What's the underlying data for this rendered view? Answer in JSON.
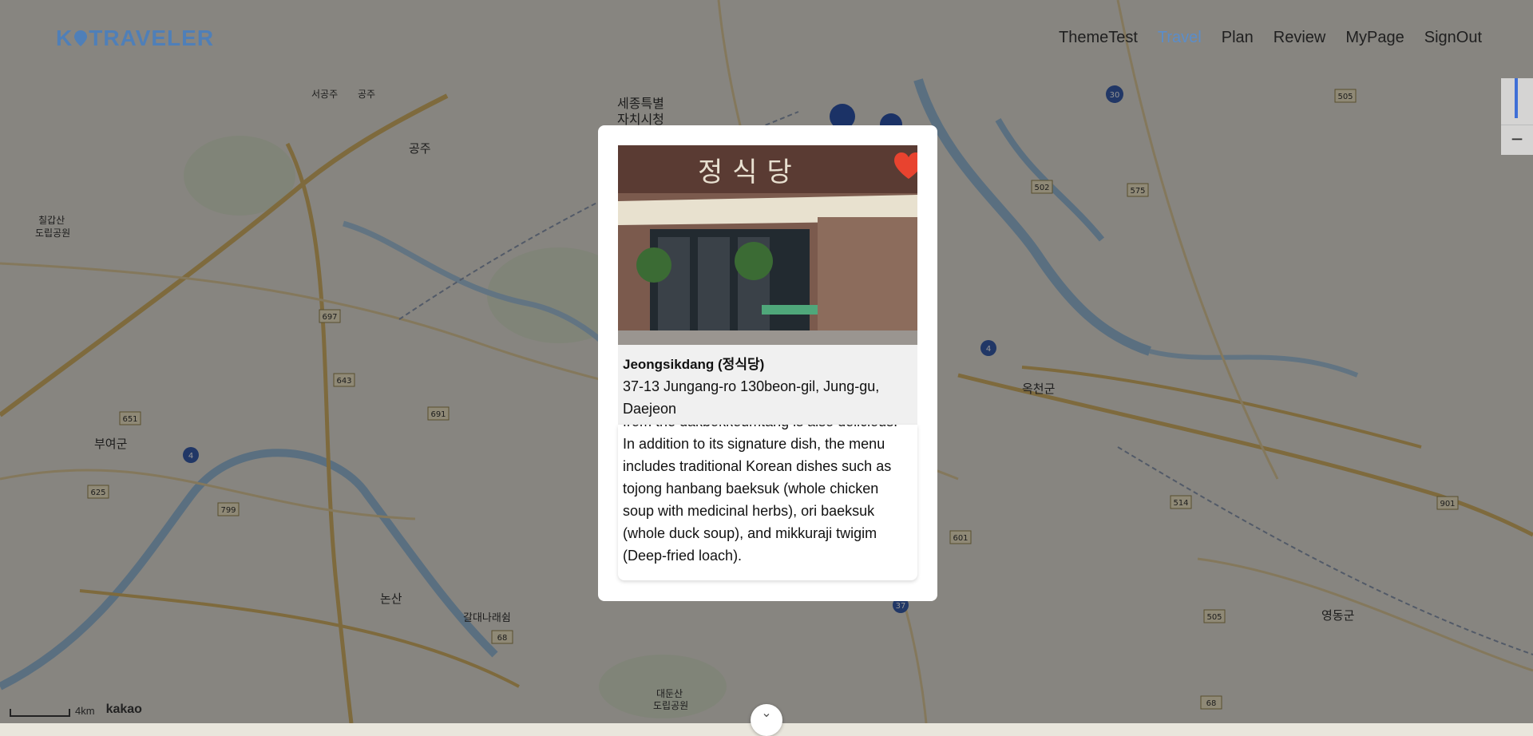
{
  "app": {
    "logo_text": "TRAVELER",
    "logo_prefix": "K"
  },
  "nav": [
    {
      "label": "ThemeTest",
      "active": false
    },
    {
      "label": "Travel",
      "active": true
    },
    {
      "label": "Plan",
      "active": false
    },
    {
      "label": "Review",
      "active": false
    },
    {
      "label": "MyPage",
      "active": false
    },
    {
      "label": "SignOut",
      "active": false
    }
  ],
  "map": {
    "labels": [
      "세종특별",
      "자치시청",
      "서공주",
      "공주",
      "공주",
      "칠갑산",
      "도립공원",
      "부여군",
      "논산",
      "갈대나래쉼",
      "대둔산",
      "도립공원",
      "옥천군",
      "영동군"
    ],
    "route_numbers": [
      "30",
      "505",
      "502",
      "575",
      "697",
      "643",
      "691",
      "651",
      "625",
      "799",
      "4",
      "4",
      "514",
      "901",
      "601",
      "37",
      "505",
      "68",
      "68"
    ],
    "scale_label": "4km",
    "provider": "kakao"
  },
  "modal": {
    "place_name": "Jeongsikdang (정식당)",
    "address": "37-13 Jungang-ro 130beon-gil, Jung-gu, Daejeon",
    "description": "from the dakbokkeumtang is also delicious. In addition to its signature dish, the menu includes traditional Korean dishes such as tojong hanbang baeksuk (whole chicken soup with medicinal herbs), ori baeksuk (whole duck soup), and mikkuraji twigim (Deep-fried loach).",
    "sign_text": "정식당",
    "favorite": true
  },
  "colors": {
    "accent": "#5b8dc9",
    "heart": "#e8432f"
  },
  "icons": [
    "heart-icon",
    "chevron-down-icon",
    "zoom-out-icon",
    "logo-pin-icon"
  ]
}
